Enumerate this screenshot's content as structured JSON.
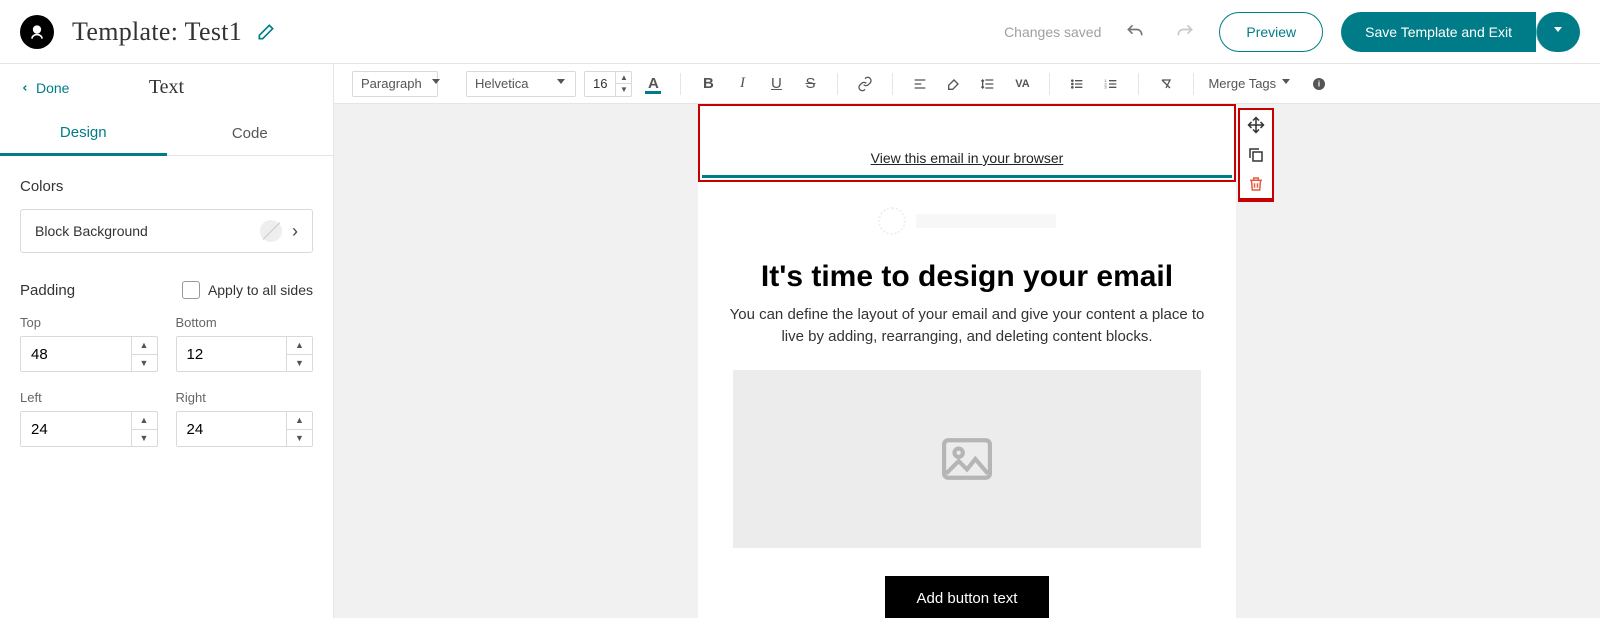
{
  "header": {
    "title": "Template: Test1",
    "saved_status": "Changes saved",
    "preview_label": "Preview",
    "save_label": "Save Template and Exit"
  },
  "sidebar": {
    "done_label": "Done",
    "panel_title": "Text",
    "tabs": {
      "design": "Design",
      "code": "Code"
    },
    "colors_section": "Colors",
    "block_bg_label": "Block Background",
    "padding_section": "Padding",
    "apply_all": "Apply to all sides",
    "padding": {
      "top_label": "Top",
      "top": "48",
      "bottom_label": "Bottom",
      "bottom": "12",
      "left_label": "Left",
      "left": "24",
      "right_label": "Right",
      "right": "24"
    }
  },
  "toolbar": {
    "paragraph": "Paragraph",
    "font_family": "Helvetica",
    "font_size": "16",
    "merge_tags": "Merge Tags"
  },
  "email": {
    "view_browser": "View this email in your browser",
    "heading": "It's time to design your email",
    "sub": "You can define the layout of your email and give your content a place to live by adding, rearranging, and deleting content blocks.",
    "button": "Add button text"
  }
}
